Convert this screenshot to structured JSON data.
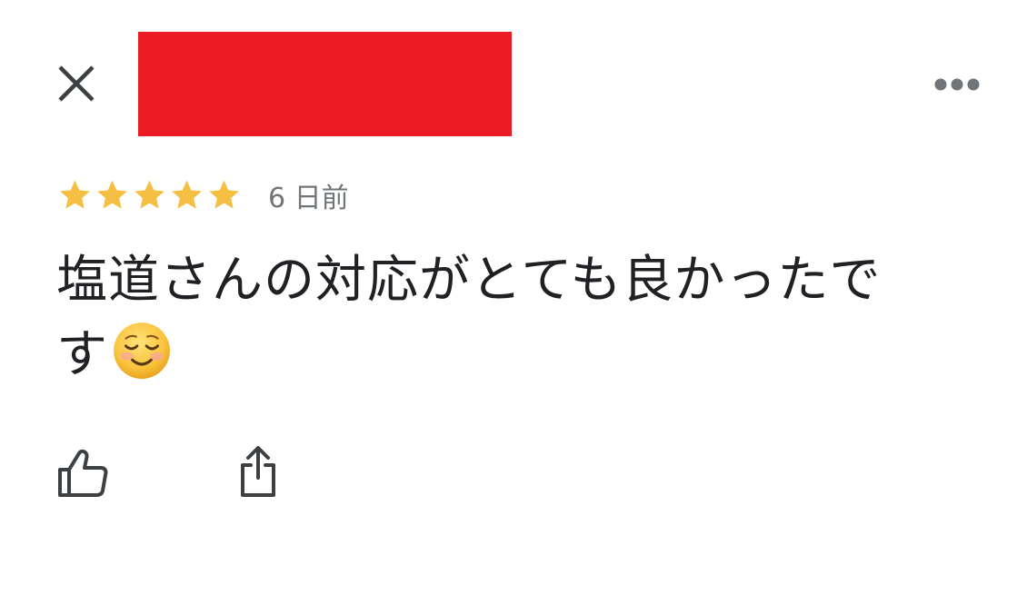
{
  "header": {
    "close_icon": "close-icon",
    "redaction_color": "#ec1c24",
    "more_icon": "more-horizontal-icon"
  },
  "review": {
    "rating": 5,
    "rating_max": 5,
    "star_color": "#f4bf42",
    "time_ago": "6 日前",
    "text": "塩道さんの対応がとても良かったです",
    "emoji": "smiling-face-icon"
  },
  "actions": {
    "like_icon": "thumbs-up-icon",
    "share_icon": "share-icon"
  },
  "colors": {
    "text_primary": "#202124",
    "text_secondary": "#70757a",
    "icon": "#3c4043"
  }
}
